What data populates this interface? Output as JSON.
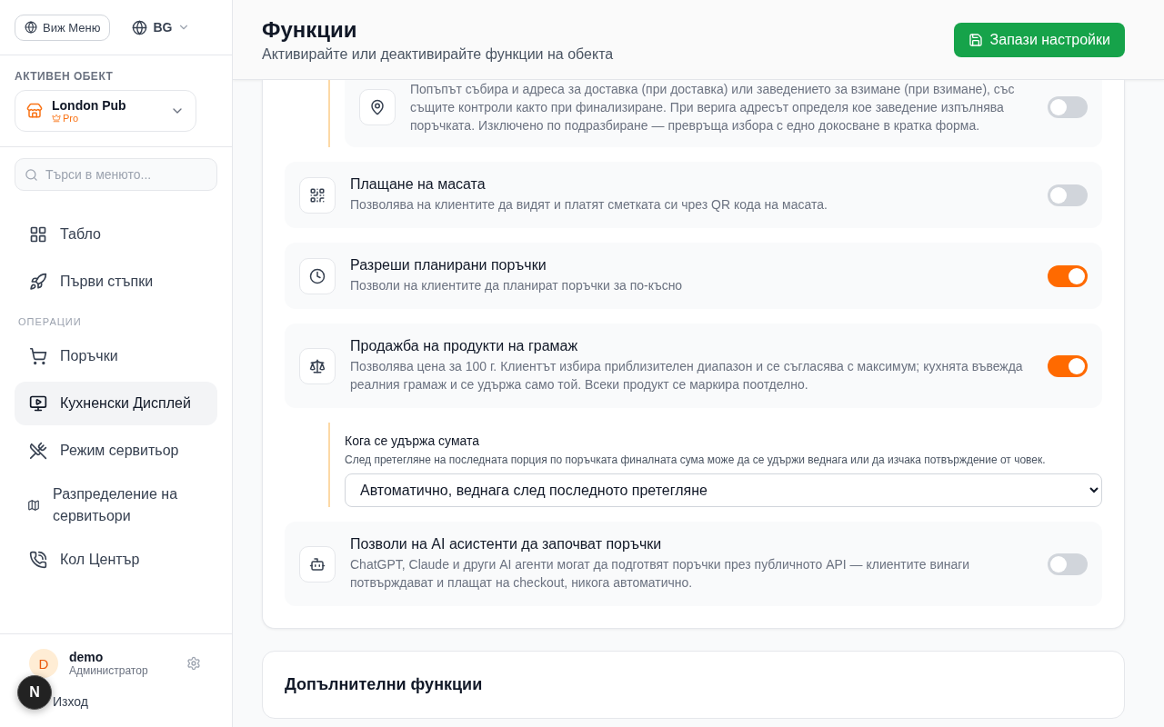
{
  "sidebar": {
    "view_menu_button": "Виж Меню",
    "language": "BG",
    "active_venue_label": "АКТИВЕН ОБЕКТ",
    "venue": {
      "name": "London Pub",
      "plan": "Pro"
    },
    "search": {
      "placeholder": "Търси в менюто..."
    },
    "nav": [
      {
        "kind": "item",
        "label": "Табло",
        "selected": false
      },
      {
        "kind": "item",
        "label": "Първи стъпки",
        "selected": false
      },
      {
        "kind": "heading",
        "label": "ОПЕРАЦИИ"
      },
      {
        "kind": "item",
        "label": "Поръчки",
        "selected": false
      },
      {
        "kind": "item",
        "label": "Кухненски Дисплей",
        "selected": true
      },
      {
        "kind": "item",
        "label": "Режим сервитьор",
        "selected": false
      },
      {
        "kind": "item",
        "label": "Разпределение на сервитьори",
        "selected": false
      },
      {
        "kind": "item",
        "label": "Кол Център",
        "selected": false
      }
    ],
    "user": {
      "initial": "D",
      "name": "demo",
      "role": "Администратор"
    },
    "logout": "Изход",
    "dev_badge": "N"
  },
  "header": {
    "title": "Функции",
    "subtitle": "Активирайте или деактивирайте функции на обекта",
    "save_button": "Запази настройки"
  },
  "features": [
    {
      "kind": "sub-toggle",
      "description": "Попъпът събира и адреса за доставка (при доставка) или заведението за взимане (при взимане), със същите контроли както при финализиране. При верига адресът определя кое заведение изпълнява поръчката. Изключено по подразбиране — превръща избора с едно докосване в кратка форма.",
      "on": false
    },
    {
      "kind": "toggle",
      "title": "Плащане на масата",
      "description": "Позволява на клиентите да видят и платят сметката си чрез QR кода на масата.",
      "on": false
    },
    {
      "kind": "toggle",
      "title": "Разреши планирани поръчки",
      "description": "Позволи на клиентите да планират поръчки за по-късно",
      "on": true
    },
    {
      "kind": "toggle",
      "title": "Продажба на продукти на грамаж",
      "description": "Позволява цена за 100 г. Клиентът избира приблизителен диапазон и се съгласява с максимум; кухнята въвежда реалния грамаж и се удържа само той. Всеки продукт се маркира поотделно.",
      "on": true
    },
    {
      "kind": "sub-select",
      "title": "Кога се удържа сумата",
      "description": "След претегляне на последната порция по поръчката финалната сума може да се удържи веднага или да изчака потвърждение от човек.",
      "value": "Автоматично, веднага след последното претегляне"
    },
    {
      "kind": "toggle",
      "title": "Позволи на AI асистенти да започват поръчки",
      "description": "ChatGPT, Claude и други AI агенти могат да подготвят поръчки през публичното API — клиентите винаги потвърждават и плащат на checkout, никога автоматично.",
      "on": false
    }
  ],
  "extra_section": {
    "title": "Допълнителни функции"
  }
}
